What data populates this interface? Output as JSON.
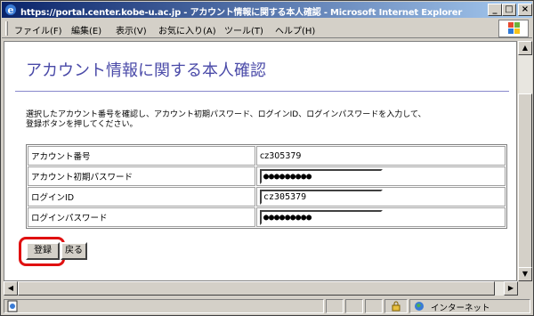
{
  "window": {
    "title": "https://portal.center.kobe-u.ac.jp - アカウント情報に関する本人確認 - Microsoft Internet Explorer",
    "minimize_label": "_",
    "maximize_label": "□",
    "close_label": "×"
  },
  "menubar": {
    "items": [
      "ファイル(F)",
      "編集(E)",
      "表示(V)",
      "お気に入り(A)",
      "ツール(T)",
      "ヘルプ(H)"
    ]
  },
  "page": {
    "heading": "アカウント情報に関する本人確認",
    "description_line1": "選択したアカウント番号を確認し、アカウント初期パスワード、ログインID、ログインパスワードを入力して、",
    "description_line2": "登録ボタンを押してください。",
    "form": {
      "rows": [
        {
          "label": "アカウント番号",
          "value": "cz305379"
        },
        {
          "label": "アカウント初期パスワード",
          "value": "●●●●●●●●●"
        },
        {
          "label": "ログインID",
          "value": "cz305379"
        },
        {
          "label": "ログインパスワード",
          "value": "●●●●●●●●●"
        }
      ]
    },
    "register_button": "登録",
    "back_button": "戻る"
  },
  "statusbar": {
    "zone": "インターネット"
  },
  "colors": {
    "title_gradient_start": "#0a246a",
    "heading": "#4a4aa8",
    "highlight": "#e01010"
  }
}
